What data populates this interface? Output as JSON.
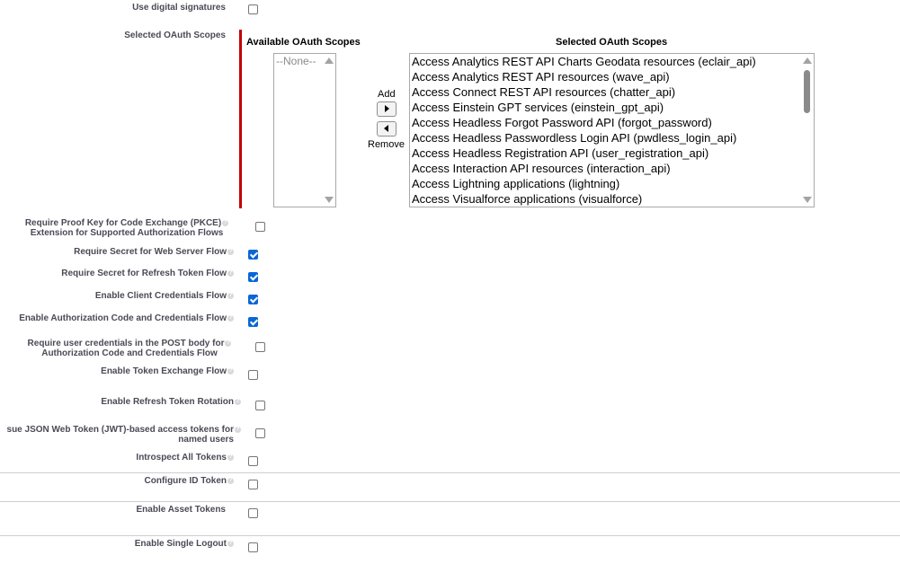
{
  "fields": {
    "digital_signatures": {
      "label": "Use digital signatures",
      "checked": false
    },
    "selected_scopes_label": "Selected OAuth Scopes",
    "pkce": {
      "label_line1": "Require Proof Key for Code Exchange (PKCE)",
      "label_line2": "Extension for Supported Authorization Flows",
      "checked": false
    },
    "secret_web_server": {
      "label": "Require Secret for Web Server Flow",
      "checked": true
    },
    "secret_refresh": {
      "label": "Require Secret for Refresh Token Flow",
      "checked": true
    },
    "client_credentials": {
      "label": "Enable Client Credentials Flow",
      "checked": true
    },
    "auth_code_credentials": {
      "label": "Enable Authorization Code and Credentials Flow",
      "checked": true
    },
    "post_body": {
      "label_line1": "Require user credentials in the POST body for",
      "label_line2": "Authorization Code and Credentials Flow",
      "checked": false
    },
    "token_exchange": {
      "label": "Enable Token Exchange Flow",
      "checked": false
    },
    "refresh_rotation": {
      "label": "Enable Refresh Token Rotation",
      "checked": false
    },
    "jwt_tokens": {
      "label_line1": "sue JSON Web Token (JWT)-based access tokens for",
      "label_line2": "named users",
      "checked": false
    },
    "introspect": {
      "label": "Introspect All Tokens",
      "checked": false
    },
    "id_token": {
      "label": "Configure ID Token",
      "checked": false
    },
    "asset_tokens": {
      "label": "Enable Asset Tokens",
      "checked": false
    },
    "single_logout": {
      "label": "Enable Single Logout",
      "checked": false
    }
  },
  "scopes": {
    "available_header": "Available OAuth Scopes",
    "selected_header": "Selected OAuth Scopes",
    "available": [
      "--None--"
    ],
    "selected": [
      "Access Analytics REST API Charts Geodata resources (eclair_api)",
      "Access Analytics REST API resources (wave_api)",
      "Access Connect REST API resources (chatter_api)",
      "Access Einstein GPT services (einstein_gpt_api)",
      "Access Headless Forgot Password API (forgot_password)",
      "Access Headless Passwordless Login API (pwdless_login_api)",
      "Access Headless Registration API (user_registration_api)",
      "Access Interaction API resources (interaction_api)",
      "Access Lightning applications (lightning)",
      "Access Visualforce applications (visualforce)"
    ],
    "add_label": "Add",
    "remove_label": "Remove"
  },
  "icons": {
    "help": "help-icon",
    "add": "arrow-right-icon",
    "remove": "arrow-left-icon"
  },
  "colors": {
    "checkbox_checked": "#0a66d6",
    "required_bar": "#c00000",
    "label_text": "#4a4a56"
  }
}
